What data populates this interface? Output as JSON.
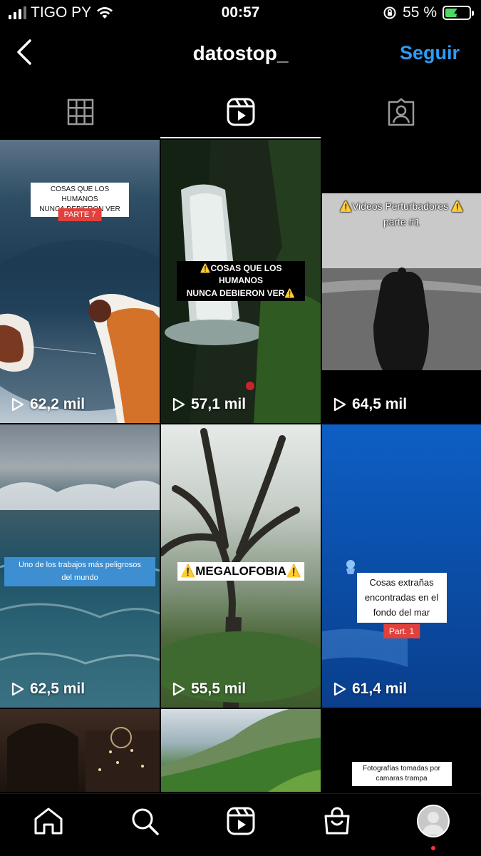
{
  "status_bar": {
    "carrier": "TIGO PY",
    "time": "00:57",
    "battery_percent": "55 %",
    "battery_level": 0.55,
    "battery_color": "#4cd964"
  },
  "header": {
    "back_icon": "chevron-left-icon",
    "username": "datostop_",
    "follow_label": "Seguir",
    "follow_color": "#2d9cf6"
  },
  "tabs": [
    {
      "icon": "grid-icon",
      "active": false
    },
    {
      "icon": "reels-icon",
      "active": true
    },
    {
      "icon": "tagged-icon",
      "active": false
    }
  ],
  "reels": [
    {
      "views": "62,2 mil",
      "caption": "COSAS QUE LOS HUMANOS\nNUNCA DEBIERON VER",
      "tag": "PARTE 7"
    },
    {
      "views": "57,1 mil",
      "caption": "⚠️COSAS QUE LOS HUMANOS\nNUNCA DEBIERON VER⚠️"
    },
    {
      "views": "64,5 mil",
      "caption": "⚠️Videos Perturbadores ⚠️\nparte #1"
    },
    {
      "views": "62,5 mil",
      "caption": "Uno de los trabajos más peligrosos\ndel mundo"
    },
    {
      "views": "55,5 mil",
      "caption": "⚠️MEGALOFOBIA⚠️"
    },
    {
      "views": "61,4 mil",
      "caption": "Cosas extrañas\nencontradas en el\nfondo del mar",
      "tag": "Part. 1"
    },
    {
      "caption": ""
    },
    {
      "caption": ""
    },
    {
      "caption": "Fotografías tomadas por\ncamaras trampa"
    }
  ],
  "bottom_nav": [
    {
      "icon": "home-icon"
    },
    {
      "icon": "search-icon"
    },
    {
      "icon": "reels-icon"
    },
    {
      "icon": "shop-icon"
    },
    {
      "icon": "profile-avatar"
    }
  ]
}
